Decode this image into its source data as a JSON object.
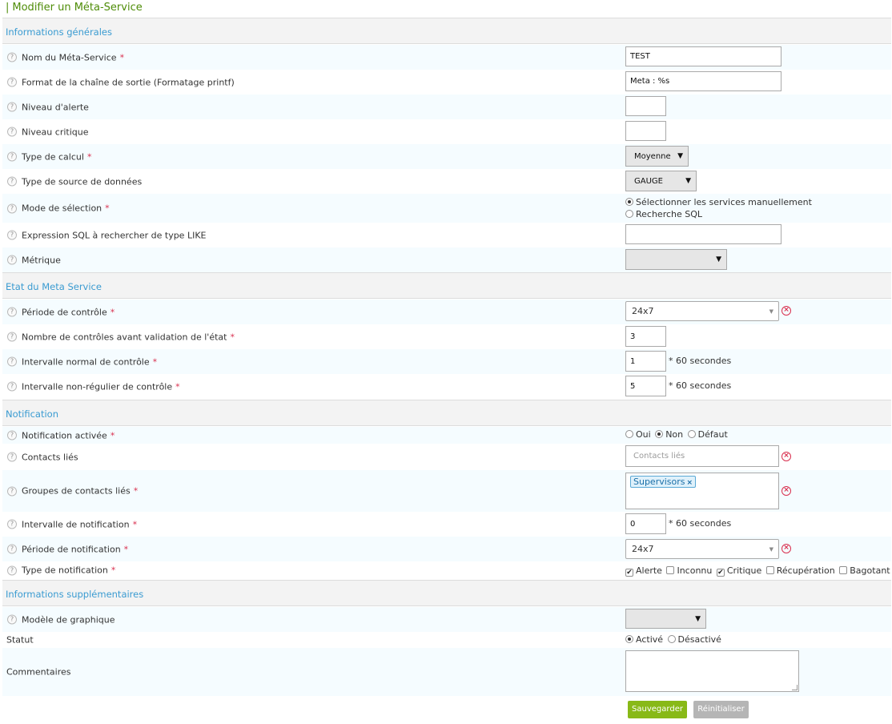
{
  "page_title": "Modifier un Méta-Service",
  "title_bar": "|",
  "help_glyph": "?",
  "required_mark": "*",
  "clear_glyph": "×",
  "checkmark": "✔",
  "sections": {
    "general": "Informations générales",
    "state": "Etat du Meta Service",
    "notification": "Notification",
    "extra": "Informations supplémentaires"
  },
  "general": {
    "name": {
      "label": "Nom du Méta-Service",
      "value": "TEST"
    },
    "output": {
      "label": "Format de la chaîne de sortie (Formatage printf)",
      "value": "Meta : %s"
    },
    "warning": {
      "label": "Niveau d'alerte",
      "value": ""
    },
    "critical": {
      "label": "Niveau critique",
      "value": ""
    },
    "calc_type": {
      "label": "Type de calcul",
      "value": "Moyenne"
    },
    "ds_type": {
      "label": "Type de source de données",
      "value": "GAUGE"
    },
    "selection_mode": {
      "label": "Mode de sélection",
      "option_manual": "Sélectionner les services manuellement",
      "option_sql": "Recherche SQL",
      "selected": "manual"
    },
    "sql_expr": {
      "label": "Expression SQL à rechercher de type LIKE",
      "value": ""
    },
    "metric": {
      "label": "Métrique",
      "value": ""
    }
  },
  "state": {
    "check_period": {
      "label": "Période de contrôle",
      "value": "24x7"
    },
    "max_attempts": {
      "label": "Nombre de contrôles avant validation de l'état",
      "value": "3"
    },
    "normal_interval": {
      "label": "Intervalle normal de contrôle",
      "value": "1",
      "suffix": "* 60 secondes"
    },
    "retry_interval": {
      "label": "Intervalle non-régulier de contrôle",
      "value": "5",
      "suffix": "* 60 secondes"
    }
  },
  "notification": {
    "enabled": {
      "label": "Notification activée",
      "opt_yes": "Oui",
      "opt_no": "Non",
      "opt_default": "Défaut",
      "selected": "Non"
    },
    "contacts": {
      "label": "Contacts liés",
      "placeholder": "Contacts liés"
    },
    "contact_groups": {
      "label": "Groupes de contacts liés",
      "tags": [
        "Supervisors"
      ]
    },
    "interval": {
      "label": "Intervalle de notification",
      "value": "0",
      "suffix": "* 60 secondes"
    },
    "period": {
      "label": "Période de notification",
      "value": "24x7"
    },
    "types": {
      "label": "Type de notification",
      "options": [
        {
          "label": "Alerte",
          "checked": true
        },
        {
          "label": "Inconnu",
          "checked": false
        },
        {
          "label": "Critique",
          "checked": true
        },
        {
          "label": "Récupération",
          "checked": false
        },
        {
          "label": "Bagotant",
          "checked": false
        }
      ]
    }
  },
  "extra": {
    "graph_template": {
      "label": "Modèle de graphique",
      "value": ""
    },
    "status": {
      "label": "Statut",
      "opt_active": "Activé",
      "opt_inactive": "Désactivé",
      "selected": "Activé"
    },
    "comments": {
      "label": "Commentaires",
      "value": ""
    }
  },
  "buttons": {
    "save": "Sauvegarder",
    "reset": "Réinitialiser"
  },
  "colors": {
    "title": "#4e8c07",
    "section_header": "#3a9bd1",
    "required": "#d9304f",
    "save_button": "#88b917",
    "reset_button": "#b5b5b5",
    "row_alt": "#f5fcff"
  }
}
